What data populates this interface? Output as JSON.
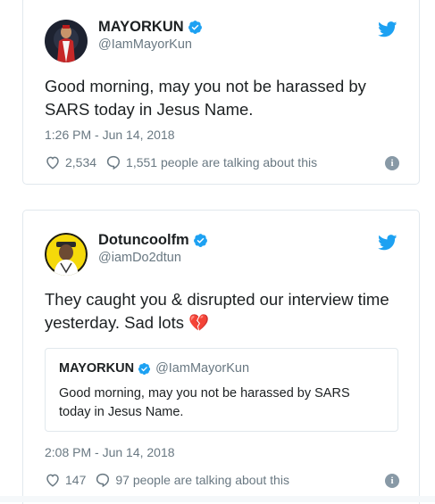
{
  "tweets": [
    {
      "name": "MAYORKUN",
      "handle": "@IamMayorKun",
      "text": "Good morning, may you not be harassed by SARS today in Jesus Name.",
      "time": "1:26 PM - Jun 14, 2018",
      "likes": "2,534",
      "talking": "1,551 people are talking about this"
    },
    {
      "name": "Dotuncoolfm",
      "handle": "@iamDo2dtun",
      "text": "They caught you & disrupted our interview time yesterday. Sad lots",
      "emoji": "💔",
      "quote": {
        "name": "MAYORKUN",
        "handle": "@IamMayorKun",
        "text": "Good morning, may you not be harassed by SARS today in Jesus Name."
      },
      "time": "2:08 PM - Jun 14, 2018",
      "likes": "147",
      "talking": "97 people are talking about this"
    }
  ],
  "colors": {
    "twitter_blue": "#1da1f2",
    "text": "#1c2022",
    "muted": "#697882",
    "border": "#e1e8ed",
    "heart": "#e0245e"
  },
  "icons": [
    "verified-badge-icon",
    "twitter-bird-icon",
    "heart-icon",
    "reply-icon",
    "info-icon"
  ]
}
